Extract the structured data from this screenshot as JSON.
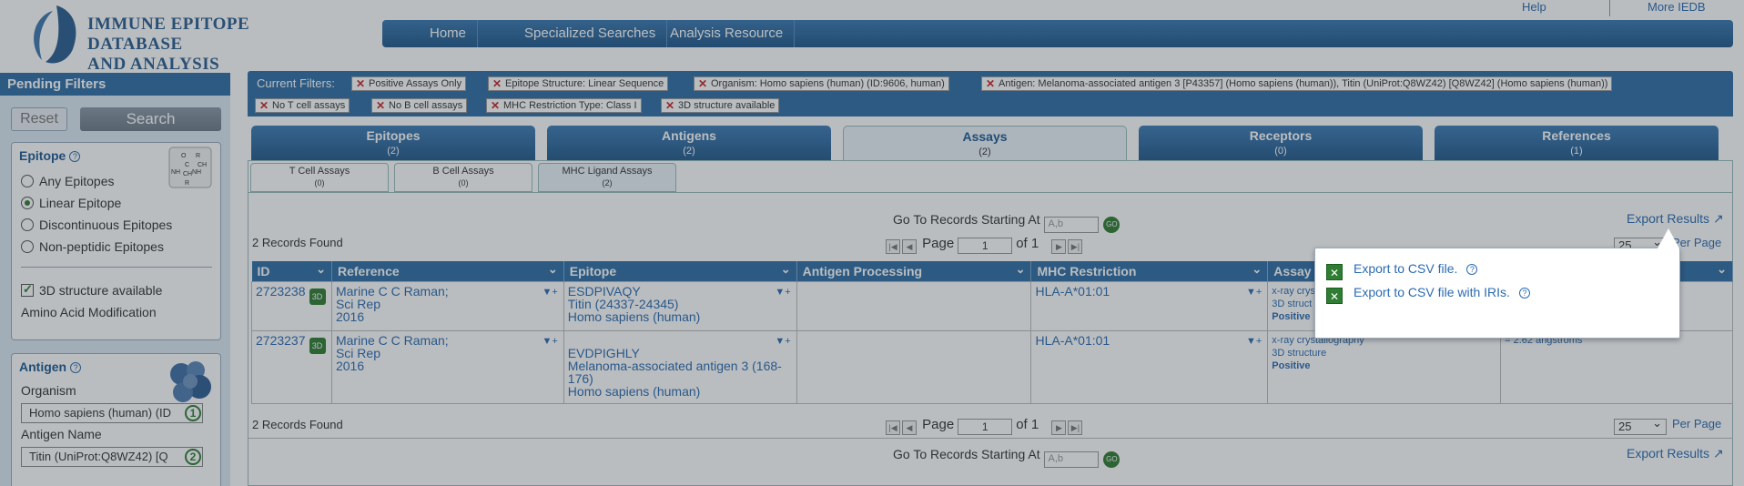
{
  "header": {
    "logo_line1": "IMMUNE EPITOPE DATABASE",
    "logo_line2": "AND ANALYSIS RESOURCE",
    "nav": [
      "Home",
      "Specialized Searches",
      "Analysis Resource"
    ],
    "help": "Help",
    "more": "More IEDB"
  },
  "sidebar": {
    "title": "Pending Filters",
    "reset": "Reset",
    "search": "Search",
    "epitope": {
      "title": "Epitope",
      "options": [
        "Any Epitopes",
        "Linear Epitope",
        "Discontinuous Epitopes",
        "Non-peptidic Epitopes"
      ],
      "selected_index": 1,
      "structure_check": "3D structure available",
      "amino": "Amino Acid Modification"
    },
    "antigen": {
      "title": "Antigen",
      "organism_label": "Organism",
      "organism_value": "Homo sapiens (human) (ID",
      "organism_badge": "1",
      "name_label": "Antigen Name",
      "name_value": "Titin (UniProt:Q8WZ42) [Q",
      "name_badge": "2"
    }
  },
  "filters": {
    "label": "Current Filters:",
    "chips": [
      "Positive Assays Only",
      "Epitope Structure: Linear Sequence",
      "Organism: Homo sapiens (human) (ID:9606, human)",
      "Antigen: Melanoma-associated antigen 3 [P43357] (Homo sapiens (human)), Titin (UniProt:Q8WZ42) [Q8WZ42] (Homo sapiens (human))",
      "No T cell assays",
      "No B cell assays",
      "MHC Restriction Type: Class I",
      "3D structure available"
    ]
  },
  "tabs": [
    {
      "label": "Epitopes",
      "count": "(2)"
    },
    {
      "label": "Antigens",
      "count": "(2)"
    },
    {
      "label": "Assays",
      "count": "(2)"
    },
    {
      "label": "Receptors",
      "count": "(0)"
    },
    {
      "label": "References",
      "count": "(1)"
    }
  ],
  "subtabs": [
    {
      "label": "T Cell Assays",
      "count": "(0)"
    },
    {
      "label": "B Cell Assays",
      "count": "(0)"
    },
    {
      "label": "MHC Ligand Assays",
      "count": "(2)"
    }
  ],
  "results": {
    "goto_label": "Go To Records Starting At",
    "goto_placeholder": "A,b",
    "go": "GO",
    "export": "Export Results",
    "records_found": "2 Records Found",
    "page_label": "Page",
    "page_value": "1",
    "of_label": "of 1",
    "per_page_value": "25",
    "per_page_label": "Per Page",
    "columns": [
      "ID",
      "Reference",
      "Epitope",
      "Antigen Processing",
      "MHC Restriction",
      "Assay D"
    ],
    "rows": [
      {
        "id": "2723238",
        "ref1": "Marine C C Raman;",
        "ref2": "Sci Rep",
        "ref3": "2016",
        "ep1": "ESDPIVAQY",
        "ep2": "Titin (24337-24345)",
        "ep3": "Homo sapiens (human)",
        "mhc": "HLA-A*01:01",
        "assay1": "x-ray crys",
        "assay2": "3D struct",
        "assay3": "Positive",
        "extra": ""
      },
      {
        "id": "2723237",
        "ref1": "Marine C C Raman;",
        "ref2": "Sci Rep",
        "ref3": "2016",
        "ep1": "EVDPIGHLY",
        "ep2": "Melanoma-associated antigen 3 (168-176)",
        "ep3": "Homo sapiens (human)",
        "mhc": "HLA-A*01:01",
        "assay1": "x-ray crystallography",
        "assay2": "3D structure",
        "assay3": "Positive",
        "extra": "= 2.62 angstroms"
      }
    ]
  },
  "popup": {
    "csv": "Export to CSV file.",
    "csv_iri": "Export to CSV file with IRIs."
  }
}
